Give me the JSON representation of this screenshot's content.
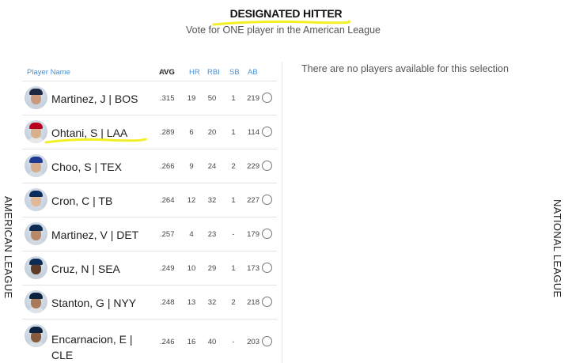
{
  "header": {
    "title": "DESIGNATED HITTER",
    "subtitle": "Vote for ONE player in the American League"
  },
  "side_labels": {
    "left": "AMERICAN LEAGUE",
    "right": "NATIONAL LEAGUE"
  },
  "table": {
    "columns": {
      "name": "Player Name",
      "avg": "AVG",
      "hr": "HR",
      "rbi": "RBI",
      "sb": "SB",
      "ab": "AB"
    },
    "sorted_by": "AVG",
    "sort_direction": "descending"
  },
  "players": [
    {
      "name": "Martinez, J | BOS",
      "avg": ".315",
      "hr": "19",
      "rbi": "50",
      "sb": "1",
      "ab": "219",
      "cap": "#1c2841",
      "shirt": "#c9d2dc",
      "skin": "#c99a7b"
    },
    {
      "name": "Ohtani, S | LAA",
      "avg": ".289",
      "hr": "6",
      "rbi": "20",
      "sb": "1",
      "ab": "114",
      "cap": "#ba0021",
      "shirt": "#e8e8e8",
      "skin": "#d9b08c"
    },
    {
      "name": "Choo, S | TEX",
      "avg": ".266",
      "hr": "9",
      "rbi": "24",
      "sb": "2",
      "ab": "229",
      "cap": "#1f3a93",
      "shirt": "#d4dbe3",
      "skin": "#d6ad8a"
    },
    {
      "name": "Cron, C | TB",
      "avg": ".264",
      "hr": "12",
      "rbi": "32",
      "sb": "1",
      "ab": "227",
      "cap": "#092c5c",
      "shirt": "#cfd8e0",
      "skin": "#e0b896"
    },
    {
      "name": "Martinez, V | DET",
      "avg": ".257",
      "hr": "4",
      "rbi": "23",
      "sb": "-",
      "ab": "179",
      "cap": "#0c2c56",
      "shirt": "#d2d9e0",
      "skin": "#b98866"
    },
    {
      "name": "Cruz, N | SEA",
      "avg": ".249",
      "hr": "10",
      "rbi": "29",
      "sb": "1",
      "ab": "173",
      "cap": "#0c2c56",
      "shirt": "#c7d0d8",
      "skin": "#5e3b26"
    },
    {
      "name": "Stanton, G | NYY",
      "avg": ".248",
      "hr": "13",
      "rbi": "32",
      "sb": "2",
      "ab": "218",
      "cap": "#0c2340",
      "shirt": "#dde3e9",
      "skin": "#a9795a"
    },
    {
      "name": "Encarnacion, E | CLE",
      "avg": ".246",
      "hr": "16",
      "rbi": "40",
      "sb": "-",
      "ab": "203",
      "cap": "#0c2340",
      "shirt": "#d8dee5",
      "skin": "#8a5a3c"
    }
  ],
  "national_league_panel": {
    "message": "There are no players available for this selection"
  },
  "annotations": {
    "highlight_color": "#f2ef24"
  }
}
